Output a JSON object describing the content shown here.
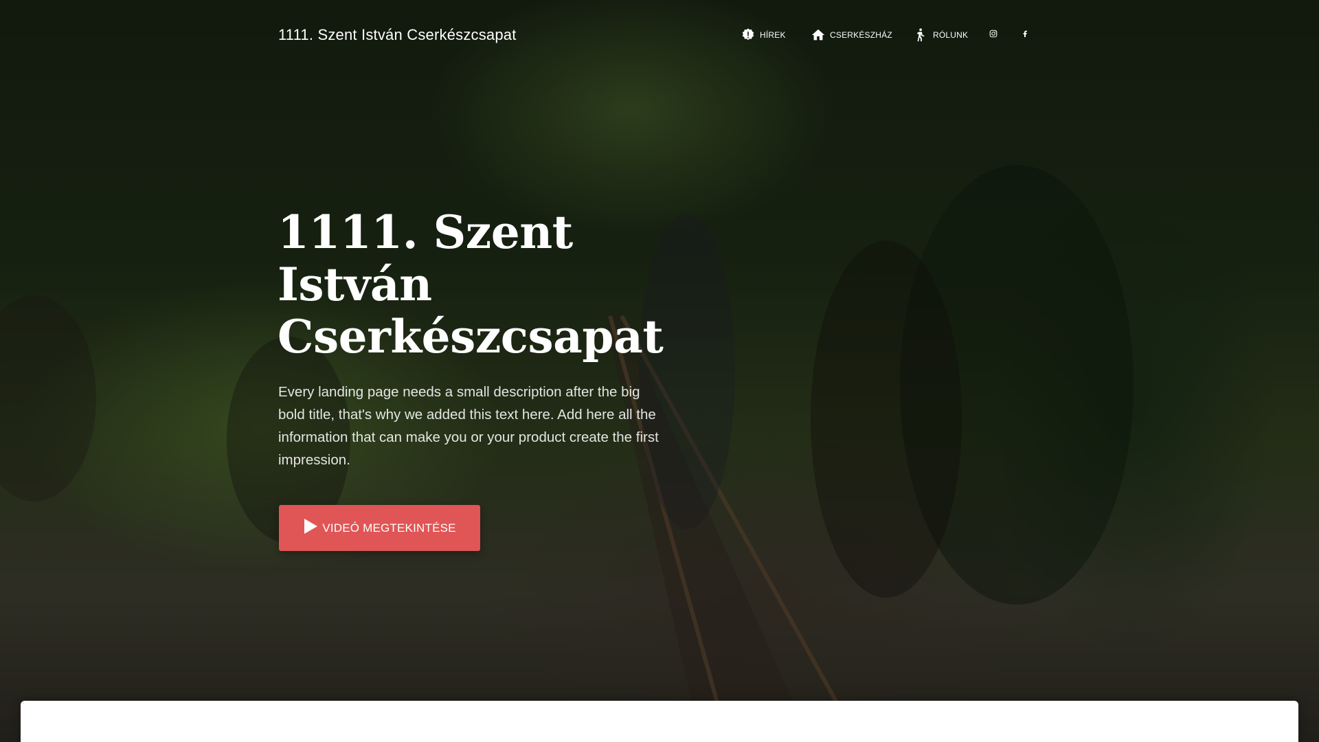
{
  "navbar": {
    "brand": "1111. Szent István Cserkészcsapat",
    "items": [
      {
        "label": "HÍREK",
        "icon": "alert-badge-icon"
      },
      {
        "label": "CSERKÉSZHÁZ",
        "icon": "home-icon"
      },
      {
        "label": "RÓLUNK",
        "icon": "hiker-icon"
      }
    ],
    "social": [
      {
        "icon": "instagram-icon"
      },
      {
        "icon": "facebook-icon"
      }
    ]
  },
  "hero": {
    "title": "1111. Szent István Cserkészcsapat",
    "description": "Every landing page needs a small description after the big bold title, that's why we added this text here. Add here all the information that can make you or your product create the first impression.",
    "cta_label": "VIDEÓ MEGTEKINTÉSE",
    "cta_icon": "play-icon"
  },
  "colors": {
    "accent": "#e05555",
    "text": "#ffffff",
    "card": "#ffffff"
  }
}
